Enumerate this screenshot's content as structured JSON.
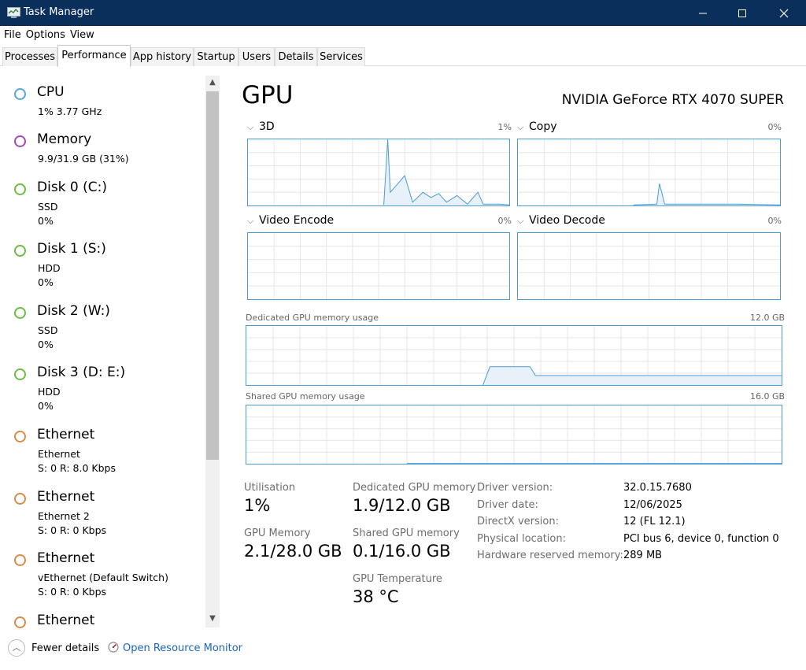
{
  "window": {
    "title": "Task Manager"
  },
  "menu": [
    "File",
    "Options",
    "View"
  ],
  "tabs": [
    "Processes",
    "Performance",
    "App history",
    "Startup",
    "Users",
    "Details",
    "Services"
  ],
  "resources": [
    {
      "name": "CPU",
      "line1": "1% 3.77 GHz",
      "line2": "",
      "color": "#5aa6d6"
    },
    {
      "name": "Memory",
      "line1": "9.9/31.9 GB (31%)",
      "line2": "",
      "color": "#a24bb8"
    },
    {
      "name": "Disk 0 (C:)",
      "line1": "SSD",
      "line2": "0%",
      "color": "#6dbd45"
    },
    {
      "name": "Disk 1 (S:)",
      "line1": "HDD",
      "line2": "0%",
      "color": "#6dbd45"
    },
    {
      "name": "Disk 2 (W:)",
      "line1": "SSD",
      "line2": "0%",
      "color": "#6dbd45"
    },
    {
      "name": "Disk 3 (D: E:)",
      "line1": "HDD",
      "line2": "0%",
      "color": "#6dbd45"
    },
    {
      "name": "Ethernet",
      "line1": "Ethernet",
      "line2": "S: 0 R: 8.0 Kbps",
      "color": "#d98c4a"
    },
    {
      "name": "Ethernet",
      "line1": "Ethernet 2",
      "line2": "S: 0 R: 0 Kbps",
      "color": "#d98c4a"
    },
    {
      "name": "Ethernet",
      "line1": "vEthernet (Default Switch)",
      "line2": "S: 0 R: 0 Kbps",
      "color": "#d98c4a"
    },
    {
      "name": "Ethernet",
      "line1": "",
      "line2": "",
      "color": "#d98c4a"
    }
  ],
  "gpu": {
    "title": "GPU",
    "model": "NVIDIA GeForce RTX 4070 SUPER",
    "engines": [
      {
        "label": "3D",
        "percent": "1%"
      },
      {
        "label": "Copy",
        "percent": "0%"
      },
      {
        "label": "Video Encode",
        "percent": "0%"
      },
      {
        "label": "Video Decode",
        "percent": "0%"
      }
    ],
    "dedicated_label": "Dedicated GPU memory usage",
    "dedicated_max": "12.0 GB",
    "shared_label": "Shared GPU memory usage",
    "shared_max": "16.0 GB",
    "stats": {
      "utilisation_label": "Utilisation",
      "utilisation": "1%",
      "dedicated_mem_label": "Dedicated GPU memory",
      "dedicated_mem": "1.9/12.0 GB",
      "gpu_mem_label": "GPU Memory",
      "gpu_mem": "2.1/28.0 GB",
      "shared_mem_label": "Shared GPU memory",
      "shared_mem": "0.1/16.0 GB",
      "temp_label": "GPU Temperature",
      "temp": "38 °C"
    },
    "info": [
      {
        "key": "Driver version:",
        "value": "32.0.15.7680"
      },
      {
        "key": "Driver date:",
        "value": "12/06/2025"
      },
      {
        "key": "DirectX version:",
        "value": "12 (FL 12.1)"
      },
      {
        "key": "Physical location:",
        "value": "PCI bus 6, device 0, function 0"
      },
      {
        "key": "Hardware reserved memory:",
        "value": "289 MB"
      }
    ]
  },
  "footer": {
    "fewer_details": "Fewer details",
    "open_monitor": "Open Resource Monitor"
  },
  "colors": {
    "graph_line": "#4b9cd3",
    "graph_fill": "#e8f1fa",
    "grid": "#e6e6e6",
    "titlebar": "#0b2f5b",
    "link": "#1a66c1"
  }
}
